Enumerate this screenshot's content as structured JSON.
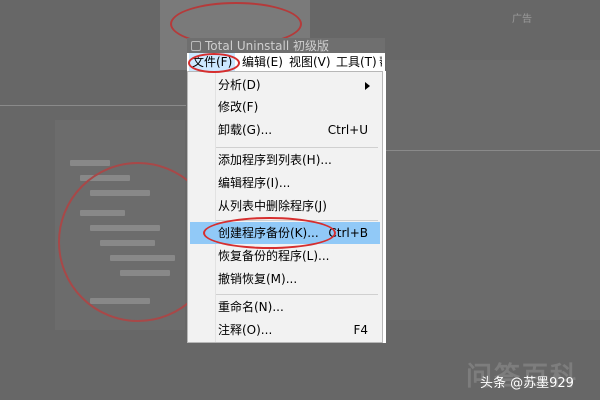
{
  "window": {
    "title": "Total Uninstall 初级版"
  },
  "background": {
    "ad_label": "广告"
  },
  "menubar": {
    "items": [
      {
        "label": "文件(F)",
        "active": true
      },
      {
        "label": "编辑(E)"
      },
      {
        "label": "视图(V)"
      },
      {
        "label": "工具(T)"
      },
      {
        "label": "帮"
      }
    ]
  },
  "file_menu": {
    "items": [
      {
        "label": "分析(D)",
        "shortcut": "",
        "submenu": true
      },
      {
        "label": "修改(F)",
        "shortcut": ""
      },
      {
        "label": "卸载(G)...",
        "shortcut": "Ctrl+U"
      },
      {
        "label": "添加程序到列表(H)...",
        "shortcut": ""
      },
      {
        "label": "编辑程序(I)...",
        "shortcut": ""
      },
      {
        "label": "从列表中删除程序(J)",
        "shortcut": ""
      },
      {
        "label": "创建程序备份(K)...",
        "shortcut": "Ctrl+B",
        "highlighted": true
      },
      {
        "label": "恢复备份的程序(L)...",
        "shortcut": ""
      },
      {
        "label": "撤销恢复(M)...",
        "shortcut": ""
      },
      {
        "label": "重命名(N)...",
        "shortcut": ""
      },
      {
        "label": "注释(O)...",
        "shortcut": "F4"
      }
    ]
  },
  "watermark": {
    "text": "问答百科"
  },
  "credit": {
    "text": "头条 @苏墨929"
  },
  "colors": {
    "highlight": "#91c9f7",
    "annotation": "#d62e2e",
    "overlay": "#676767"
  }
}
